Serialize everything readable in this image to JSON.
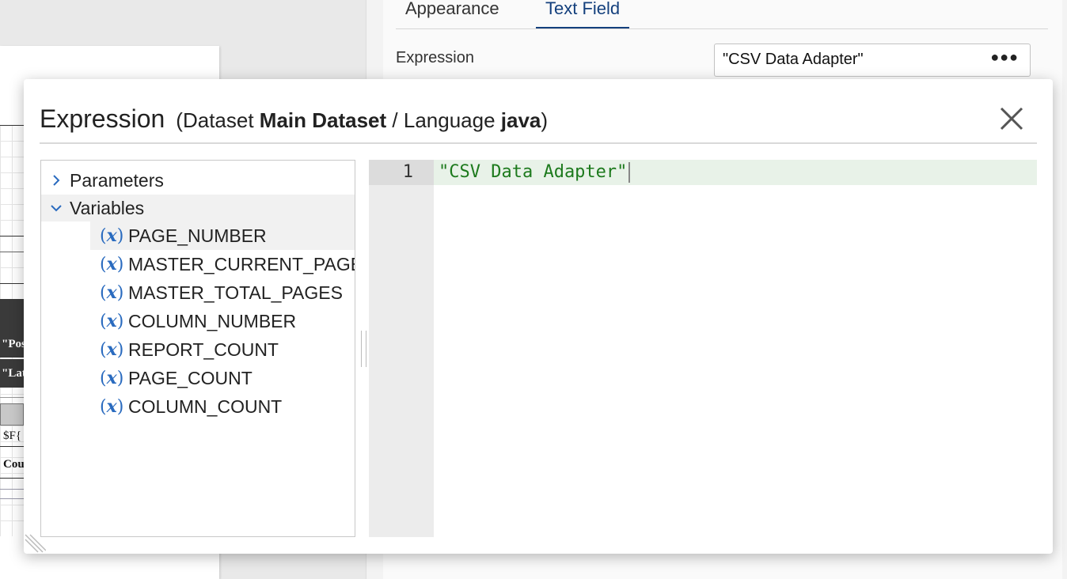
{
  "properties_panel": {
    "tabs": [
      {
        "label": "Appearance",
        "active": false
      },
      {
        "label": "Text Field",
        "active": true
      }
    ],
    "expression_label": "Expression",
    "expression_value": "\"CSV Data Adapter\""
  },
  "background_report": {
    "cells": [
      "\"Pos",
      "\"Lat",
      "$F{",
      "Coun"
    ]
  },
  "dialog": {
    "title": "Expression",
    "subtitle_prefix": "(Dataset ",
    "dataset": "Main Dataset",
    "subtitle_mid": " / Language ",
    "language": "java",
    "subtitle_suffix": ")",
    "tree": {
      "parameters": {
        "label": "Parameters",
        "expanded": false
      },
      "variables": {
        "label": "Variables",
        "expanded": true,
        "icon": "variable-x-icon",
        "items": [
          {
            "label": "PAGE_NUMBER",
            "selected": true
          },
          {
            "label": "MASTER_CURRENT_PAGE",
            "selected": false
          },
          {
            "label": "MASTER_TOTAL_PAGES",
            "selected": false
          },
          {
            "label": "COLUMN_NUMBER",
            "selected": false
          },
          {
            "label": "REPORT_COUNT",
            "selected": false
          },
          {
            "label": "PAGE_COUNT",
            "selected": false
          },
          {
            "label": "COLUMN_COUNT",
            "selected": false
          }
        ]
      }
    },
    "editor": {
      "line_number": "1",
      "code": "\"CSV Data Adapter\""
    }
  },
  "colors": {
    "accent": "#14407d",
    "variable_icon": "#2a6bbf",
    "code_string": "#1d7a1d"
  }
}
